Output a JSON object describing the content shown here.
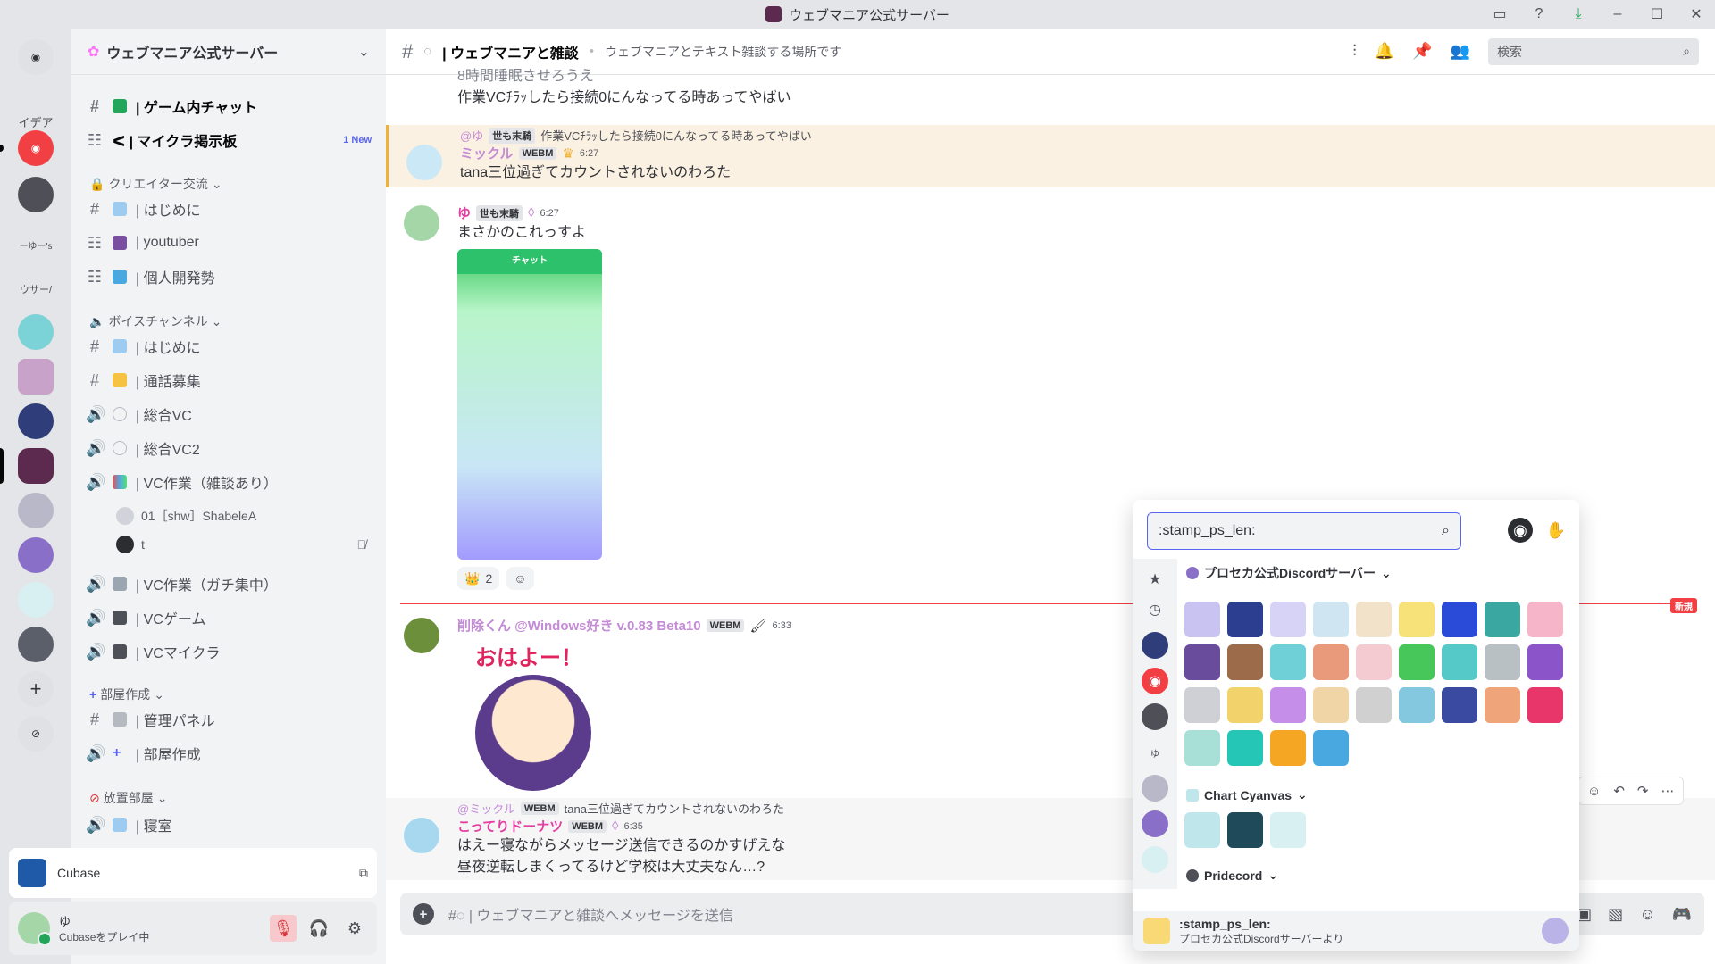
{
  "window": {
    "title": "ウェブマニア公式サーバー"
  },
  "rail": {
    "labels": [
      "イデア",
      "ーゆー's",
      "ウサー/"
    ]
  },
  "sidebar": {
    "server_name": "ウェブマニア公式サーバー",
    "channels_top": [
      {
        "label": "| ゲーム内チャット",
        "bold": true
      },
      {
        "label": "ᐸ | マイクラ掲示板",
        "bold": true,
        "badge": "1 New"
      }
    ],
    "cat_creator": "クリエイター交流",
    "creator_channels": [
      "| はじめに",
      "| youtuber",
      "| 個人開発勢"
    ],
    "cat_voice": "ボイスチャンネル",
    "voice_channels": [
      "| はじめに",
      "| 通話募集",
      "| 総合VC",
      "| 総合VC2",
      "| VC作業（雑談あり）"
    ],
    "voice_users": [
      "01［shw］ShabeleA",
      "t"
    ],
    "voice_channels2": [
      "| VC作業（ガチ集中）",
      "| VCゲーム",
      "| VCマイクラ"
    ],
    "cat_room": "部屋作成",
    "room_channels": [
      "| 管理パネル",
      "| 部屋作成"
    ],
    "cat_abandon": "放置部屋",
    "abandon_channels": [
      "| 寝室"
    ]
  },
  "app_card": {
    "label": "Cubase"
  },
  "user_panel": {
    "name": "ゆ",
    "status": "Cubaseをプレイ中"
  },
  "chat": {
    "channel": "| ウェブマニアと雑談",
    "topic": "ウェブマニアとテキスト雑談する場所です",
    "search_placeholder": "検索"
  },
  "messages": {
    "partial_top": "8時間睡眠させろうえ",
    "m0_text": "作業VCﾁﾗｯしたら接続0にんなってる時あってやばい",
    "m1": {
      "reply_name": "@ゆ",
      "reply_tag": "世も末騎",
      "reply_text": "作業VCﾁﾗｯしたら接続0にんなってる時あってやばい",
      "name": "ミックル",
      "tag": "WEBM",
      "time": "6:27",
      "text": "tana三位過ぎてカウントされないのわろた"
    },
    "m2": {
      "name": "ゆ",
      "tag": "世も末騎",
      "time": "6:27",
      "text": "まさかのこれっすよ",
      "image_header": "チャット",
      "reaction_count": "2"
    },
    "m3": {
      "name": "削除くん @Windows好き v.0.83 Beta10",
      "tag": "WEBM",
      "time": "6:33",
      "sticker": "おはよー！"
    },
    "m4": {
      "reply_name": "@ミックル",
      "reply_tag": "WEBM",
      "reply_text": "tana三位過ぎてカウントされないのわろた",
      "name": "こってりドーナツ",
      "tag": "WEBM",
      "time": "6:35",
      "text1": "はえー寝ながらメッセージ送信できるのかすげえな",
      "text2": "昼夜逆転しまくってるけど学校は大丈夫なん…?"
    },
    "new_label": "新規"
  },
  "composer": {
    "placeholder": "#◌ | ウェブマニアと雑談へメッセージを送信"
  },
  "picker": {
    "query": ":stamp_ps_len:",
    "section1": "プロセカ公式Discordサーバー",
    "section2": "Chart Cyanvas",
    "section3": "Pridecord",
    "preview_name": ":stamp_ps_len:",
    "preview_source": "プロセカ公式Discordサーバーより",
    "emoji_colors": [
      "#c9c3f2",
      "#2c3e8f",
      "#d7d3f7",
      "#cfe6f2",
      "#f2e2c9",
      "#f7e27a",
      "#2a4bd8",
      "#3aa8a0",
      "#f7b5c9",
      "#6a4c9c",
      "#9c6b4a",
      "#6fd0d8",
      "#e89a7a",
      "#f5cbd2",
      "#47c75a",
      "#55c8c8",
      "#b9c0c4",
      "#8b54c9",
      "#cfcfd6",
      "#f2d36b",
      "#c58ee8",
      "#f0d6a6",
      "#d0d0d0",
      "#84c8e0",
      "#3a4aa0",
      "#f0a47a",
      "#e8356a",
      "#a8e0d8",
      "#26c6b6",
      "#f5a623",
      "#4aa8e0"
    ],
    "chart_colors": [
      "#bfe6ea",
      "#1f4a5a",
      "#d8f0f2"
    ]
  }
}
